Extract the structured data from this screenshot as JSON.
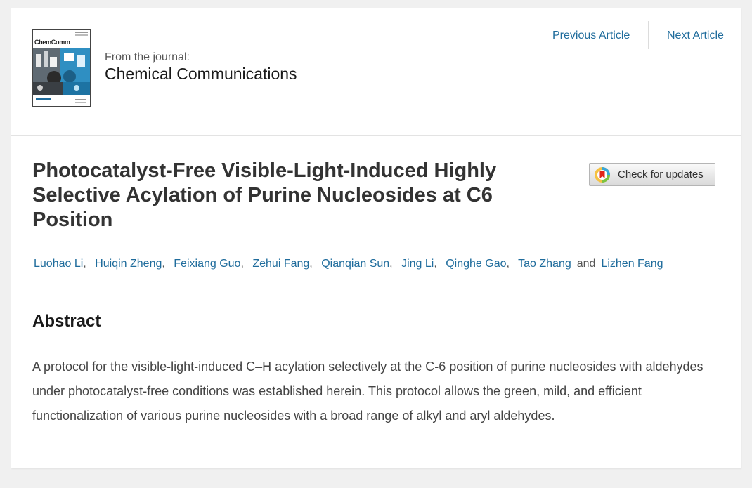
{
  "journal": {
    "cover_title": "ChemComm",
    "from_label": "From the journal:",
    "name": "Chemical Communications"
  },
  "nav": {
    "previous_label": "Previous Article",
    "next_label": "Next Article"
  },
  "article": {
    "title": "Photocatalyst-Free Visible-Light-Induced Highly Selective Acylation of Purine Nucleosides at C6 Position",
    "check_updates_label": "Check for updates",
    "authors": [
      "Luohao Li",
      "Huiqin Zheng",
      "Feixiang Guo",
      "Zehui Fang",
      "Qianqian Sun",
      "Jing Li",
      "Qinghe Gao",
      "Tao Zhang",
      "Lizhen Fang"
    ],
    "and_label": "and",
    "abstract_heading": "Abstract",
    "abstract_text": "A protocol for the visible-light-induced C–H acylation selectively at the C-6 position of purine nucleosides with aldehydes under photocatalyst-free conditions was established herein. This protocol allows the green, mild, and efficient functionalization of various purine nucleosides with a broad range of alkyl and aryl aldehydes."
  },
  "colors": {
    "link": "#1f6c9c",
    "title": "#333333",
    "background": "#f0f0f0"
  }
}
